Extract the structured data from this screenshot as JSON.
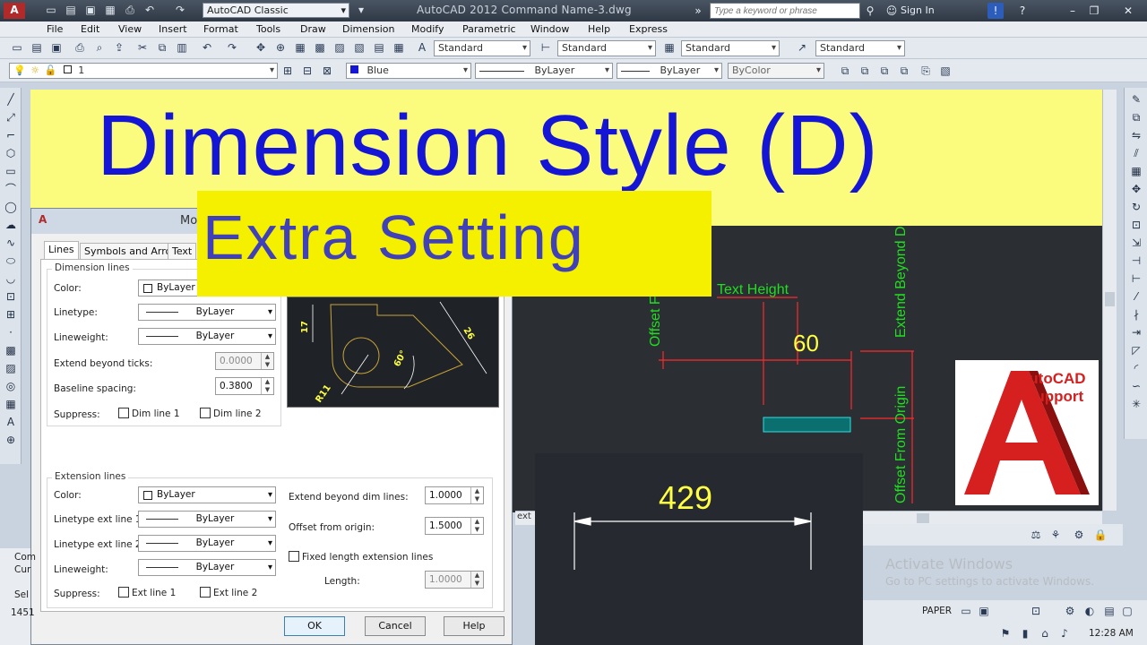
{
  "window": {
    "title": "AutoCAD 2012    Command Name-3.dwg",
    "workspace": "AutoCAD Classic",
    "search_placeholder": "Type a keyword or phrase",
    "sign_in": "Sign In"
  },
  "menu": [
    "File",
    "Edit",
    "View",
    "Insert",
    "Format",
    "Tools",
    "Draw",
    "Dimension",
    "Modify",
    "Parametric",
    "Window",
    "Help",
    "Express"
  ],
  "styles_toolbar": {
    "text_style": "Standard",
    "dim_style": "Standard",
    "table_style": "Standard",
    "multileader_style": "Standard"
  },
  "layers_toolbar": {
    "layer": "1",
    "color": "Blue",
    "linetype": "ByLayer",
    "lineweight": "ByLayer",
    "plotstyle": "ByColor"
  },
  "headline": "Dimension Style (D)",
  "subtitle": "Extra Setting",
  "dialog": {
    "title": "Mo",
    "tabs": [
      "Lines",
      "Symbols and Arrows",
      "Text"
    ],
    "dimension_lines": {
      "group": "Dimension lines",
      "color_label": "Color:",
      "color_value": "ByLayer",
      "linetype_label": "Linetype:",
      "linetype_value": "ByLayer",
      "lineweight_label": "Lineweight:",
      "lineweight_value": "ByLayer",
      "extend_label": "Extend beyond ticks:",
      "extend_value": "0.0000",
      "baseline_label": "Baseline spacing:",
      "baseline_value": "0.3800",
      "suppress_label": "Suppress:",
      "dim1": "Dim line 1",
      "dim2": "Dim line 2"
    },
    "extension_lines": {
      "group": "Extension lines",
      "color_label": "Color:",
      "color_value": "ByLayer",
      "lt1_label": "Linetype ext line 1:",
      "lt1_value": "ByLayer",
      "lt2_label": "Linetype ext line 2:",
      "lt2_value": "ByLayer",
      "lineweight_label": "Lineweight:",
      "lineweight_value": "ByLayer",
      "suppress_label": "Suppress:",
      "ext1": "Ext line 1",
      "ext2": "Ext line 2",
      "extend_label": "Extend beyond dim lines:",
      "extend_value": "1.0000",
      "offset_label": "Offset from origin:",
      "offset_value": "1.5000",
      "fixed_label": "Fixed length extension lines",
      "length_label": "Length:",
      "length_value": "1.0000"
    },
    "preview": {
      "dim_17": "17",
      "dim_26": "26",
      "dim_60": "60°",
      "dim_r11": "R11"
    },
    "buttons": {
      "ok": "OK",
      "cancel": "Cancel",
      "help": "Help"
    }
  },
  "annotations": {
    "text_height": "Text Height",
    "value_60": "60",
    "offset_dim": "Offset From Dim Lines",
    "extend_beyond": "Extend Beyond Dim Lines",
    "offset_origin": "Offset From Origin",
    "inset_value": "429",
    "cmd_fragment": "ext"
  },
  "logo": {
    "line1": "AutoCAD",
    "line2": "Support"
  },
  "command_area": {
    "line1": "Com",
    "line2": "Cur",
    "line3": "Sel",
    "coords": "1451"
  },
  "watermark": {
    "line1": "Activate Windows",
    "line2": "Go to PC settings to activate Windows."
  },
  "status": {
    "paper": "PAPER",
    "time": "12:28 AM"
  },
  "colors": {
    "headline_blue": "#1515d6",
    "banner_yellow": "#fbfb7e",
    "subtitle_bg": "#f5f000",
    "annotation_green": "#22dd22",
    "dim_red": "#ff2a2a",
    "dim_yellow": "#ffff44"
  }
}
